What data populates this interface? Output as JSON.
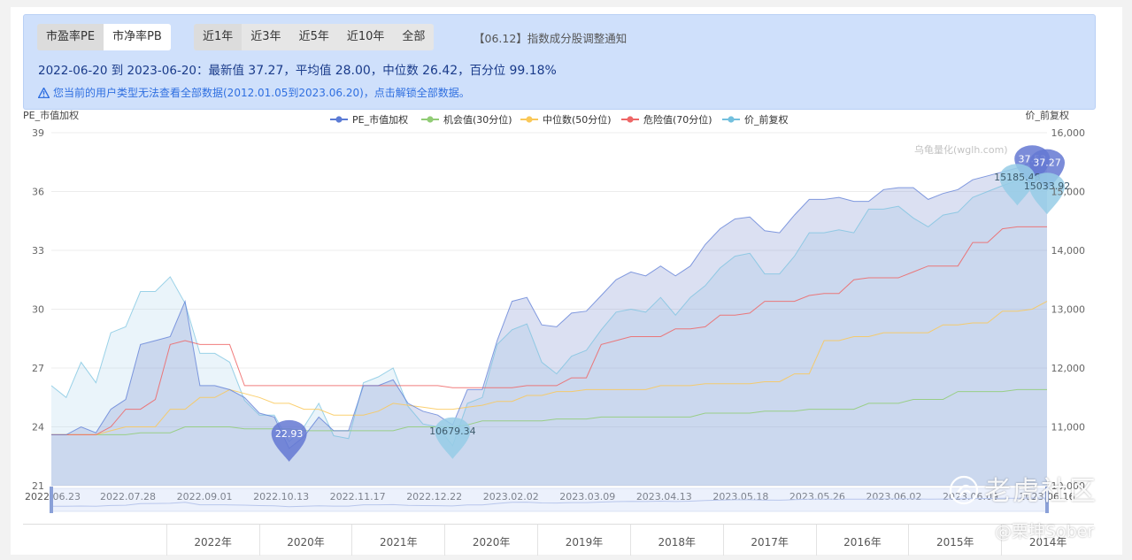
{
  "tabs_metric": [
    {
      "label": "市盈率PE",
      "selected": true
    },
    {
      "label": "市净率PB",
      "selected": false
    }
  ],
  "tabs_range": [
    {
      "label": "近1年",
      "selected": true
    },
    {
      "label": "近3年",
      "selected": false
    },
    {
      "label": "近5年",
      "selected": false
    },
    {
      "label": "近10年",
      "selected": false
    },
    {
      "label": "全部",
      "selected": false
    }
  ],
  "notice": "【06.12】指数成分股调整通知",
  "stats": {
    "range": "2022-06-20 到 2023-06-20：",
    "latest_label": "最新值",
    "latest": "37.27",
    "mean_label": "，平均值",
    "mean": "28.00",
    "median_label": "，中位数",
    "median": "26.42",
    "pct_label": "，百分位",
    "pct": "99.18%"
  },
  "warning": "您当前的用户类型无法查看全部数据(2012.01.05到2023.06.20)，点击解锁全部数据。",
  "watermark_top": "乌龟量化(wglh.com)",
  "watermark_brand": "老虎社区",
  "watermark_user": "@栗坤Sober",
  "bottom_cells": [
    "",
    "2022年",
    "2020年",
    "2021年",
    "2020年",
    "2019年",
    "2018年",
    "2017年",
    "2016年",
    "2015年",
    "2014年"
  ],
  "chart_data": {
    "type": "line",
    "ylabel_left": "PE_市值加权",
    "ylabel_right": "价_前复权",
    "ylim_left": [
      21,
      39
    ],
    "yticks_left": [
      21,
      24,
      27,
      30,
      33,
      36,
      39
    ],
    "ylim_right": [
      10000,
      16000
    ],
    "yticks_right": [
      "10,000",
      "11,000",
      "12,000",
      "13,000",
      "14,000",
      "15,000",
      "16,000"
    ],
    "yticks_right_values": [
      10000,
      11000,
      12000,
      13000,
      14000,
      15000,
      16000
    ],
    "x_ticks": [
      "2022.06.23",
      "2022.07.28",
      "2022.09.01",
      "2022.10.13",
      "2022.11.17",
      "2022.12.22",
      "2023.02.02",
      "2023.03.09",
      "2023.04.13",
      "2023.05.18",
      "2023.05.26",
      "2023.06.02",
      "2023.06.09",
      "2023.06.16"
    ],
    "legend": [
      {
        "name": "PE_市值加权",
        "color": "#5b7bd5"
      },
      {
        "name": "机会值(30分位)",
        "color": "#91cc75"
      },
      {
        "name": "中位数(50分位)",
        "color": "#fac858"
      },
      {
        "name": "危险值(70分位)",
        "color": "#ee6666"
      },
      {
        "name": "价_前复权",
        "color": "#73c0de"
      }
    ],
    "series": [
      {
        "name": "PE_市值加权",
        "axis": "left",
        "values": [
          23.6,
          23.6,
          24.0,
          23.7,
          24.9,
          25.4,
          28.2,
          28.4,
          28.6,
          30.4,
          26.1,
          26.1,
          25.9,
          25.5,
          24.7,
          24.5,
          22.9,
          23.5,
          24.5,
          23.8,
          23.8,
          26.1,
          26.1,
          26.4,
          25.2,
          24.8,
          24.6,
          24.1,
          25.9,
          25.9,
          28.4,
          30.4,
          30.6,
          29.2,
          29.1,
          29.8,
          29.9,
          30.7,
          31.5,
          31.9,
          31.7,
          32.2,
          31.7,
          32.2,
          33.3,
          34.1,
          34.6,
          34.7,
          34.0,
          33.9,
          34.8,
          35.6,
          35.6,
          35.7,
          35.5,
          35.5,
          36.1,
          36.2,
          36.2,
          35.6,
          35.9,
          36.1,
          36.6,
          36.8,
          37.0,
          37.2,
          37.5,
          37.3
        ]
      },
      {
        "name": "机会值(30分位)",
        "axis": "left",
        "values": [
          23.6,
          23.6,
          23.6,
          23.6,
          23.6,
          23.6,
          23.7,
          23.7,
          23.7,
          24.0,
          24.0,
          24.0,
          24.0,
          23.9,
          23.9,
          23.9,
          23.9,
          23.8,
          23.8,
          23.8,
          23.8,
          23.8,
          23.8,
          23.8,
          24.0,
          24.0,
          24.0,
          24.0,
          24.1,
          24.3,
          24.3,
          24.3,
          24.3,
          24.3,
          24.4,
          24.4,
          24.4,
          24.5,
          24.5,
          24.5,
          24.5,
          24.5,
          24.5,
          24.5,
          24.7,
          24.7,
          24.7,
          24.7,
          24.8,
          24.8,
          24.8,
          24.9,
          24.9,
          24.9,
          24.9,
          25.2,
          25.2,
          25.2,
          25.4,
          25.4,
          25.4,
          25.8,
          25.8,
          25.8,
          25.8,
          25.9,
          25.9,
          25.9
        ]
      },
      {
        "name": "中位数(50分位)",
        "axis": "left",
        "values": [
          23.6,
          23.6,
          23.6,
          23.6,
          23.8,
          24.0,
          24.0,
          24.0,
          24.9,
          24.9,
          25.5,
          25.5,
          25.9,
          25.7,
          25.5,
          25.2,
          25.2,
          24.9,
          24.9,
          24.6,
          24.6,
          24.6,
          24.8,
          25.2,
          25.1,
          25.0,
          24.9,
          24.9,
          25.0,
          25.1,
          25.3,
          25.3,
          25.6,
          25.6,
          25.8,
          25.8,
          25.9,
          25.9,
          25.9,
          25.9,
          25.9,
          26.1,
          26.1,
          26.1,
          26.2,
          26.2,
          26.2,
          26.2,
          26.3,
          26.3,
          26.7,
          26.7,
          28.4,
          28.4,
          28.6,
          28.6,
          28.8,
          28.8,
          28.8,
          28.8,
          29.2,
          29.2,
          29.3,
          29.3,
          29.9,
          29.9,
          30.0,
          30.4
        ]
      },
      {
        "name": "危险值(70分位)",
        "axis": "left",
        "values": [
          23.6,
          23.6,
          23.6,
          23.6,
          24.0,
          24.9,
          24.9,
          25.4,
          28.2,
          28.4,
          28.2,
          28.2,
          28.2,
          26.1,
          26.1,
          26.1,
          26.1,
          26.1,
          26.1,
          26.1,
          26.1,
          26.1,
          26.1,
          26.1,
          26.1,
          26.1,
          26.1,
          26.0,
          26.0,
          26.0,
          26.0,
          26.0,
          26.1,
          26.1,
          26.1,
          26.5,
          26.5,
          28.2,
          28.4,
          28.6,
          28.6,
          28.6,
          29.0,
          29.0,
          29.1,
          29.7,
          29.7,
          29.8,
          30.4,
          30.4,
          30.4,
          30.7,
          30.8,
          30.8,
          31.5,
          31.6,
          31.6,
          31.6,
          31.9,
          32.2,
          32.2,
          32.2,
          33.4,
          33.4,
          34.1,
          34.2,
          34.2,
          34.2
        ]
      },
      {
        "name": "价_前复权",
        "axis": "right",
        "values": [
          11700,
          11500,
          12100,
          11750,
          12600,
          12700,
          13300,
          13300,
          13550,
          13100,
          12250,
          12250,
          12100,
          11450,
          11200,
          11200,
          10750,
          11000,
          11400,
          10850,
          10800,
          11750,
          11850,
          12000,
          11350,
          11050,
          11000,
          10680,
          11400,
          11500,
          12400,
          12650,
          12750,
          12100,
          11900,
          12200,
          12300,
          12650,
          12950,
          13000,
          12950,
          13200,
          12900,
          13200,
          13400,
          13700,
          13900,
          13950,
          13600,
          13600,
          13900,
          14300,
          14300,
          14350,
          14300,
          14700,
          14700,
          14750,
          14550,
          14400,
          14600,
          14650,
          14900,
          15000,
          15100,
          15185,
          15100,
          15034
        ]
      }
    ],
    "markers": [
      {
        "series": "PE_市值加权",
        "value": "22.93",
        "index": 16
      },
      {
        "series": "价_前复权",
        "value": "10679.34",
        "index": 27
      },
      {
        "series": "PE_市值加权",
        "value": "37.53",
        "index": 66
      },
      {
        "series": "PE_市值加权",
        "value": "37.27",
        "index": 67
      },
      {
        "series": "价_前复权",
        "value": "15185.48",
        "index": 65
      },
      {
        "series": "价_前复权",
        "value": "15033.92",
        "index": 67
      }
    ],
    "grid": true,
    "legend_position": "top-center"
  }
}
